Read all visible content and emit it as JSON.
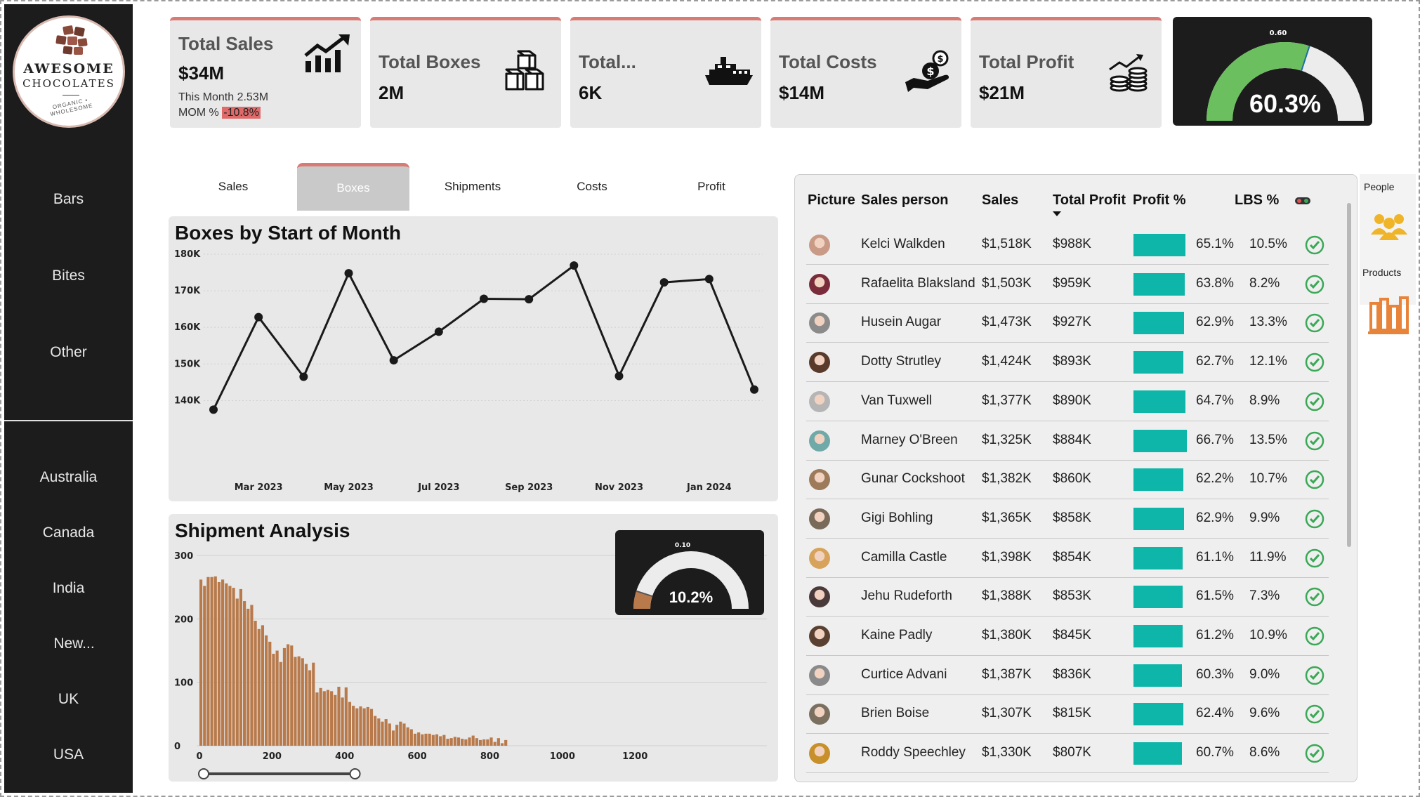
{
  "brand": {
    "line1": "AWESOME",
    "line2": "CHOCOLATES",
    "tagline": "ORGANIC • WHOLESOME"
  },
  "nav": {
    "categories": [
      "Bars",
      "Bites",
      "Other"
    ],
    "countries": [
      "Australia",
      "Canada",
      "India",
      "New...",
      "UK",
      "USA"
    ]
  },
  "kpis": {
    "sales": {
      "title": "Total Sales",
      "value": "$34M",
      "month_label": "This Month 2.53M",
      "mom_label": "MOM %",
      "mom_value": "-10.8%",
      "icon": "trend-up-icon"
    },
    "boxes": {
      "title": "Total Boxes",
      "value": "2M",
      "icon": "boxes-icon"
    },
    "shipments": {
      "title": "Total...",
      "value": "6K",
      "icon": "ship-icon"
    },
    "costs": {
      "title": "Total Costs",
      "value": "$14M",
      "icon": "money-hand-icon"
    },
    "profit": {
      "title": "Total Profit",
      "value": "$21M",
      "icon": "coins-icon"
    }
  },
  "profit_gauge": {
    "target_label": "0.60",
    "value_label": "60.3%",
    "value": 0.603,
    "target": 0.6,
    "fill_color": "#6cbf5f"
  },
  "tabs": [
    "Sales",
    "Boxes",
    "Shipments",
    "Costs",
    "Profit"
  ],
  "active_tab": "Boxes",
  "boxes_chart": {
    "title": "Boxes by Start of Month",
    "chart_data": {
      "type": "line",
      "x": [
        "Feb 2023",
        "Mar 2023",
        "Apr 2023",
        "May 2023",
        "Jun 2023",
        "Jul 2023",
        "Aug 2023",
        "Sep 2023",
        "Oct 2023",
        "Nov 2023",
        "Dec 2023",
        "Jan 2024",
        "Feb 2024"
      ],
      "values": [
        137500,
        162800,
        146500,
        174800,
        151000,
        158800,
        167800,
        167700,
        176900,
        146700,
        172300,
        173200,
        143000
      ],
      "ylim": [
        137000,
        180000
      ],
      "yticks": [
        "140K",
        "150K",
        "160K",
        "170K",
        "180K"
      ],
      "xticks": [
        "Mar 2023",
        "May 2023",
        "Jul 2023",
        "Sep 2023",
        "Nov 2023",
        "Jan 2024"
      ],
      "grid": true
    }
  },
  "shipment_chart": {
    "title": "Shipment Analysis",
    "gauge": {
      "target_label": "0.10",
      "value_label": "10.2%",
      "value": 0.102,
      "target": 0.1,
      "fill_color": "#b87a4b"
    },
    "chart_data": {
      "type": "bar",
      "bin_width": 10,
      "x_start": 0,
      "values": [
        262,
        252,
        266,
        266,
        267,
        258,
        262,
        256,
        252,
        249,
        232,
        247,
        228,
        216,
        222,
        197,
        184,
        190,
        174,
        164,
        145,
        150,
        132,
        154,
        160,
        158,
        140,
        141,
        138,
        129,
        119,
        131,
        84,
        91,
        86,
        88,
        86,
        80,
        93,
        76,
        92,
        69,
        63,
        59,
        62,
        59,
        61,
        58,
        47,
        43,
        38,
        42,
        35,
        24,
        33,
        38,
        35,
        29,
        26,
        19,
        21,
        18,
        19,
        19,
        17,
        18,
        15,
        17,
        11,
        12,
        14,
        13,
        11,
        10,
        13,
        16,
        12,
        9,
        10,
        10,
        13,
        6,
        12,
        4,
        9
      ],
      "ylim": [
        0,
        310
      ],
      "yticks": [
        "0",
        "100",
        "200",
        "300"
      ],
      "xticks": [
        "0",
        "200",
        "400",
        "600",
        "800",
        "1000",
        "1200"
      ],
      "grid": true,
      "bar_color": "#b87a4b",
      "slider_range": [
        0,
        430
      ]
    }
  },
  "table": {
    "headers": {
      "picture": "Picture",
      "person": "Sales person",
      "sales": "Sales",
      "profit": "Total Profit",
      "pct": "Profit %",
      "lbs": "LBS %"
    },
    "rows": [
      {
        "name": "Kelci Walkden",
        "sales": "$1,518K",
        "profit": "$988K",
        "pct": "65.1%",
        "pct_value": 0.651,
        "lbs": "10.5%",
        "avatar": "#c99a86"
      },
      {
        "name": "Rafaelita Blaksland",
        "sales": "$1,503K",
        "profit": "$959K",
        "pct": "63.8%",
        "pct_value": 0.638,
        "lbs": "8.2%",
        "avatar": "#7a2c3a"
      },
      {
        "name": "Husein Augar",
        "sales": "$1,473K",
        "profit": "$927K",
        "pct": "62.9%",
        "pct_value": 0.629,
        "lbs": "13.3%",
        "avatar": "#8b8b8b"
      },
      {
        "name": "Dotty Strutley",
        "sales": "$1,424K",
        "profit": "$893K",
        "pct": "62.7%",
        "pct_value": 0.627,
        "lbs": "12.1%",
        "avatar": "#5a3a2a"
      },
      {
        "name": "Van Tuxwell",
        "sales": "$1,377K",
        "profit": "$890K",
        "pct": "64.7%",
        "pct_value": 0.647,
        "lbs": "8.9%",
        "avatar": "#b5b5b5"
      },
      {
        "name": "Marney O'Breen",
        "sales": "$1,325K",
        "profit": "$884K",
        "pct": "66.7%",
        "pct_value": 0.667,
        "lbs": "13.5%",
        "avatar": "#6fa9a8"
      },
      {
        "name": "Gunar Cockshoot",
        "sales": "$1,382K",
        "profit": "$860K",
        "pct": "62.2%",
        "pct_value": 0.622,
        "lbs": "10.7%",
        "avatar": "#9c7a5a"
      },
      {
        "name": "Gigi Bohling",
        "sales": "$1,365K",
        "profit": "$858K",
        "pct": "62.9%",
        "pct_value": 0.629,
        "lbs": "9.9%",
        "avatar": "#7a6a5a"
      },
      {
        "name": "Camilla Castle",
        "sales": "$1,398K",
        "profit": "$854K",
        "pct": "61.1%",
        "pct_value": 0.611,
        "lbs": "11.9%",
        "avatar": "#d7a35a"
      },
      {
        "name": "Jehu Rudeforth",
        "sales": "$1,388K",
        "profit": "$853K",
        "pct": "61.5%",
        "pct_value": 0.615,
        "lbs": "7.3%",
        "avatar": "#4a3a3a"
      },
      {
        "name": "Kaine Padly",
        "sales": "$1,380K",
        "profit": "$845K",
        "pct": "61.2%",
        "pct_value": 0.612,
        "lbs": "10.9%",
        "avatar": "#5a4030"
      },
      {
        "name": "Curtice Advani",
        "sales": "$1,387K",
        "profit": "$836K",
        "pct": "60.3%",
        "pct_value": 0.603,
        "lbs": "9.0%",
        "avatar": "#8a8a8a"
      },
      {
        "name": "Brien Boise",
        "sales": "$1,307K",
        "profit": "$815K",
        "pct": "62.4%",
        "pct_value": 0.624,
        "lbs": "9.6%",
        "avatar": "#7b7060"
      },
      {
        "name": "Roddy Speechley",
        "sales": "$1,330K",
        "profit": "$807K",
        "pct": "60.7%",
        "pct_value": 0.607,
        "lbs": "8.6%",
        "avatar": "#c8902a"
      }
    ]
  },
  "side_panel": {
    "people_label": "People",
    "products_label": "Products",
    "people_icon": "people-icon",
    "products_icon": "products-icon"
  },
  "colors": {
    "accent": "#d97a74",
    "teal": "#0db6a8",
    "check_green": "#3aa856",
    "dark": "#1c1c1c",
    "products_orange": "#e8833a",
    "people_gold": "#f0b429"
  }
}
